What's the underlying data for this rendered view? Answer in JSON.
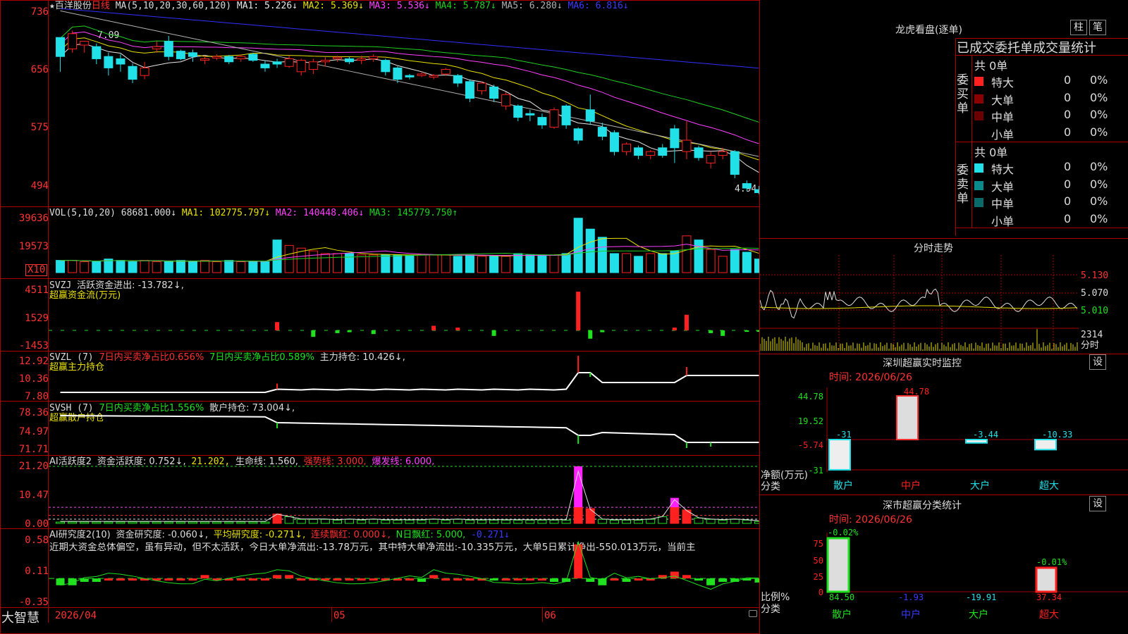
{
  "colors": {
    "up": "#ff2020",
    "down": "#22e0e8",
    "ma1": "#e8e8e8",
    "ma2": "#e8e000",
    "ma3": "#ff40ff",
    "ma4": "#20d020",
    "ma5": "#b0b0b0",
    "ma6": "#3030ff",
    "grid": "#a00000",
    "green": "#20e020"
  },
  "main": {
    "star": "★",
    "stock_name": "百洋股份",
    "period": "日线",
    "ma_label": "MA(5,10,20,30,60,120)",
    "ma1": "MA1: 5.226↓",
    "ma2": "MA2: 5.369↓",
    "ma3": "MA3: 5.536↓",
    "ma4": "MA4: 5.787↓",
    "ma5": "MA5: 6.280↓",
    "ma6": "MA6: 6.816↓",
    "high_label": "7.09",
    "low_label": "4.94",
    "y_ticks": [
      "736",
      "656",
      "575",
      "494"
    ]
  },
  "vol": {
    "label": "VOL(5,10,20)",
    "value": "68681.000↓",
    "ma1": "MA1: 102775.797↓",
    "ma2": "MA2: 140448.406↓",
    "ma3": "MA3: 145779.750↑",
    "y_ticks": [
      "39636",
      "19573"
    ],
    "unit": "X10"
  },
  "svzj": {
    "label": "SVZJ",
    "text": "活跃资金进出: -13.782↓,",
    "sub": "超赢资金流(万元)",
    "y_ticks": [
      "4511",
      "1529",
      "-1453"
    ]
  },
  "svzl": {
    "label": "SVZL (7)",
    "t1": "7日内买卖净占比0.656%",
    "t2": "7日内买卖净占比0.589%",
    "t3": "主力持仓: 10.426↓,",
    "sub": "超赢主力持仓",
    "y_ticks": [
      "12.92",
      "10.36",
      "7.80"
    ]
  },
  "svsh": {
    "label": "SVSH (7)",
    "t1": "7日内买卖净占比1.556%",
    "t2": "散户持仓: 73.004↓,",
    "sub": "超赢散户持仓",
    "y_ticks": [
      "78.36",
      "74.97",
      "71.71"
    ]
  },
  "ai2": {
    "label": "AI活跃度2",
    "t1": "资金活跃度: 0.752↓,",
    "t2": "21.202,",
    "t3": "生命线: 1.560,",
    "t4": "强势线: 3.000,",
    "t5": "爆发线: 6.000,",
    "y_ticks": [
      "21.20",
      "10.47",
      "0.00"
    ]
  },
  "ai_research": {
    "label": "AI研究度2(10)",
    "t1": "资金研究度: -0.060↓,",
    "t2": "平均研究度: -0.271↓,",
    "t3": "连续飘红: 0.000↓,",
    "t4": "N日飘红: 5.000,",
    "t5": "-0.271↓",
    "comment": "近期大资金总体偏空，虽有异动，但不太活跃，今日大单净流出:-13.78万元，其中特大单净流出:-10.335万元，大单5日累计净出-550.013万元，当前主",
    "y_ticks": [
      "0.58",
      "0.11",
      "-0.35"
    ]
  },
  "bottom": {
    "brand": "大智慧",
    "dates": [
      "2026/04",
      "05",
      "06"
    ]
  },
  "right": {
    "lhb_title": "龙虎看盘(逐单)",
    "btn1": "柱",
    "btn2": "笔",
    "tabs": "已成交委托单成交量统计",
    "buy": {
      "label": "委买单",
      "count": "共 0单",
      "rows": [
        {
          "name": "特大",
          "v": "0",
          "p": "0%"
        },
        {
          "name": "大单",
          "v": "0",
          "p": "0%"
        },
        {
          "name": "中单",
          "v": "0",
          "p": "0%"
        },
        {
          "name": "小单",
          "v": "0",
          "p": "0%"
        }
      ]
    },
    "sell": {
      "label": "委卖单",
      "count": "共 0单",
      "rows": [
        {
          "name": "特大",
          "v": "0",
          "p": "0%"
        },
        {
          "name": "大单",
          "v": "0",
          "p": "0%"
        },
        {
          "name": "中单",
          "v": "0",
          "p": "0%"
        },
        {
          "name": "小单",
          "v": "0",
          "p": "0%"
        }
      ]
    },
    "intraday_title": "分时走势",
    "intraday_ticks": [
      "5.130",
      "5.070",
      "5.010",
      "2314",
      "分时"
    ],
    "monitor": {
      "title": "深圳超赢实时监控",
      "btn": "设",
      "time": "时间: 2026/06/26",
      "y_ticks": [
        "44.78",
        "19.52",
        "-5.74",
        "-31"
      ],
      "ylabel": "净额(万元)",
      "xlabel": "分类",
      "cats": [
        "散户",
        "中户",
        "大户",
        "超大"
      ],
      "values": [
        "-31",
        "44.78",
        "-3.44",
        "-10.33"
      ]
    },
    "classify": {
      "title": "深市超赢分类统计",
      "btn": "设",
      "time": "时间: 2026/06/26",
      "y_ticks": [
        "75",
        "50",
        "25",
        "0"
      ],
      "ylabel": "比例%",
      "xlabel": "分类",
      "cats": [
        "散户",
        "中户",
        "大户",
        "超大"
      ],
      "top_labels": [
        "-0.02%",
        "-0.01%"
      ],
      "bottom_vals": [
        "84.50",
        "-1.93",
        "-19.91",
        "37.34"
      ]
    }
  },
  "chart_data": [
    {
      "type": "candlestick",
      "title": "百洋股份 日线",
      "ylim": [
        4.9,
        7.4
      ],
      "ohlc": [
        [
          7.0,
          6.75,
          6.55,
          6.98
        ],
        [
          6.85,
          7.05,
          6.8,
          7.09
        ],
        [
          6.9,
          6.95,
          6.8,
          6.9
        ],
        [
          6.88,
          6.72,
          6.65,
          6.92
        ],
        [
          6.75,
          6.6,
          6.5,
          6.8
        ],
        [
          6.72,
          6.65,
          6.55,
          6.78
        ],
        [
          6.62,
          6.45,
          6.4,
          6.66
        ],
        [
          6.5,
          6.6,
          6.45,
          6.68
        ],
        [
          6.85,
          6.88,
          6.8,
          6.95
        ],
        [
          6.95,
          6.75,
          6.7,
          7.02
        ],
        [
          6.82,
          6.72,
          6.7,
          6.84
        ],
        [
          6.8,
          6.75,
          6.68,
          6.84
        ],
        [
          6.7,
          6.72,
          6.65,
          6.76
        ],
        [
          6.73,
          6.75,
          6.7,
          6.78
        ],
        [
          6.75,
          6.68,
          6.65,
          6.77
        ],
        [
          6.72,
          6.75,
          6.68,
          6.78
        ],
        [
          6.78,
          6.7,
          6.68,
          6.8
        ],
        [
          6.65,
          6.6,
          6.55,
          6.7
        ],
        [
          6.68,
          6.65,
          6.6,
          6.72
        ],
        [
          6.62,
          6.72,
          6.6,
          6.76
        ],
        [
          6.55,
          6.7,
          6.5,
          6.72
        ],
        [
          6.58,
          6.68,
          6.52,
          6.72
        ],
        [
          6.68,
          6.7,
          6.62,
          6.74
        ],
        [
          6.72,
          6.74,
          6.68,
          6.76
        ],
        [
          6.72,
          6.68,
          6.65,
          6.75
        ],
        [
          6.7,
          6.72,
          6.65,
          6.76
        ],
        [
          6.72,
          6.75,
          6.68,
          6.78
        ],
        [
          6.7,
          6.55,
          6.5,
          6.72
        ],
        [
          6.6,
          6.45,
          6.4,
          6.62
        ],
        [
          6.5,
          6.48,
          6.45,
          6.52
        ],
        [
          6.5,
          6.52,
          6.48,
          6.55
        ],
        [
          6.48,
          6.5,
          6.45,
          6.52
        ],
        [
          6.52,
          6.58,
          6.5,
          6.6
        ],
        [
          6.5,
          6.4,
          6.35,
          6.52
        ],
        [
          6.42,
          6.2,
          6.15,
          6.45
        ],
        [
          6.3,
          6.4,
          6.25,
          6.42
        ],
        [
          6.35,
          6.2,
          6.15,
          6.38
        ],
        [
          6.1,
          6.25,
          6.05,
          6.28
        ],
        [
          6.1,
          5.95,
          5.9,
          6.12
        ],
        [
          6.0,
          5.98,
          5.9,
          6.05
        ],
        [
          5.95,
          5.85,
          5.8,
          6.0
        ],
        [
          5.82,
          6.05,
          5.8,
          6.08
        ],
        [
          6.1,
          5.85,
          5.8,
          6.12
        ],
        [
          5.8,
          5.65,
          5.6,
          5.82
        ],
        [
          6.05,
          5.9,
          5.85,
          6.25
        ],
        [
          5.82,
          5.7,
          5.65,
          5.88
        ],
        [
          5.75,
          5.5,
          5.45,
          5.78
        ],
        [
          5.5,
          5.6,
          5.45,
          5.62
        ],
        [
          5.55,
          5.45,
          5.4,
          5.58
        ],
        [
          5.45,
          5.5,
          5.4,
          5.52
        ],
        [
          5.55,
          5.45,
          5.42,
          5.6
        ],
        [
          5.8,
          5.55,
          5.35,
          5.85
        ],
        [
          5.5,
          5.65,
          5.4,
          5.9
        ],
        [
          5.55,
          5.42,
          5.38,
          5.58
        ],
        [
          5.35,
          5.45,
          5.28,
          5.5
        ],
        [
          5.45,
          5.5,
          5.4,
          5.55
        ],
        [
          5.5,
          5.2,
          5.15,
          5.52
        ],
        [
          5.08,
          5.02,
          4.98,
          5.12
        ],
        [
          5.0,
          4.96,
          4.94,
          5.05
        ]
      ],
      "x_labels": [
        "2026/04",
        "05",
        "06"
      ]
    },
    {
      "type": "bar",
      "title": "VOL(5,10,20)",
      "y_ticks": [
        39636,
        19573
      ],
      "values": [
        9,
        9,
        8,
        8,
        10,
        9,
        8,
        9,
        8,
        8,
        9,
        8,
        9,
        8,
        9,
        8,
        8,
        8,
        24,
        20,
        18,
        16,
        14,
        14,
        14,
        13,
        13,
        13,
        13,
        13,
        13,
        13,
        13,
        12,
        13,
        12,
        12,
        12,
        14,
        13,
        13,
        13,
        14,
        40,
        32,
        26,
        14,
        14,
        12,
        14,
        14,
        16,
        27,
        24,
        17,
        12,
        17,
        15,
        10
      ]
    },
    {
      "type": "bar",
      "title": "SVZJ 活跃资金进出",
      "ylim": [
        -1453,
        4511
      ],
      "values": [
        0,
        0,
        0,
        0,
        0,
        0,
        0,
        0,
        0,
        0,
        0,
        0,
        0,
        0,
        0,
        0,
        0,
        0,
        900,
        0,
        0,
        -700,
        0,
        -300,
        -200,
        0,
        -400,
        0,
        0,
        0,
        0,
        500,
        0,
        300,
        0,
        0,
        -600,
        0,
        0,
        0,
        0,
        0,
        0,
        4200,
        -900,
        -200,
        0,
        0,
        0,
        0,
        0,
        300,
        1700,
        0,
        -300,
        -600,
        0,
        -100,
        -13.782
      ]
    },
    {
      "type": "line",
      "title": "SVZL 主力持仓",
      "ylim": [
        7.8,
        12.92
      ],
      "last": 10.426
    },
    {
      "type": "line",
      "title": "SVSH 散户持仓",
      "ylim": [
        71.71,
        78.36
      ],
      "last": 73.004
    },
    {
      "type": "bar",
      "title": "AI活跃度2",
      "ylim": [
        0,
        21.2
      ],
      "values": [
        0.5,
        0.5,
        0.5,
        0.5,
        0.5,
        0.5,
        0.5,
        0.5,
        0.5,
        0.5,
        0.5,
        0.5,
        0.5,
        0.5,
        0.5,
        0.5,
        0.5,
        0.5,
        3.5,
        2.5,
        1.5,
        1.5,
        1.5,
        1.2,
        1.5,
        1.2,
        1.5,
        1.2,
        1.2,
        1.2,
        1.2,
        1.5,
        1.2,
        1.5,
        1.2,
        1.2,
        1.2,
        1.2,
        1.2,
        1.2,
        1.2,
        1.2,
        1.2,
        21.2,
        5.5,
        1.5,
        1.2,
        1.2,
        1.2,
        1.5,
        2.5,
        9.5,
        5.0,
        2.0,
        1.5,
        1.2,
        1.5,
        1.2,
        0.752
      ]
    },
    {
      "type": "bar",
      "title": "AI研究度2(10)",
      "ylim": [
        -0.35,
        0.58
      ],
      "values": [
        -0.1,
        -0.1,
        -0.05,
        -0.05,
        0,
        0,
        0,
        0,
        0,
        0,
        0,
        0,
        0.05,
        0,
        0,
        0,
        0,
        0,
        0.05,
        0.05,
        0,
        0,
        0,
        0,
        0,
        0,
        0,
        0,
        0,
        0,
        -0.05,
        0.05,
        0,
        0,
        0,
        0,
        -0.02,
        0,
        0,
        0,
        0,
        -0.05,
        -0.05,
        0.5,
        -0.05,
        -0.1,
        0,
        -0.05,
        0,
        0,
        0.05,
        0.1,
        0.05,
        -0.02,
        -0.1,
        -0.05,
        -0.05,
        -0.03,
        -0.06
      ]
    },
    {
      "type": "line",
      "title": "分时走势",
      "ylim": [
        4.98,
        5.16
      ]
    },
    {
      "type": "bar",
      "title": "深圳超赢实时监控",
      "categories": [
        "散户",
        "中户",
        "大户",
        "超大"
      ],
      "values": [
        -31,
        44.78,
        -3.44,
        -10.33
      ],
      "ylabel": "净额(万元)",
      "xlabel": "分类"
    },
    {
      "type": "bar",
      "title": "深市超赢分类统计",
      "categories": [
        "散户",
        "中户",
        "大户",
        "超大"
      ],
      "values": [
        84.5,
        -1.93,
        -19.91,
        37.34
      ],
      "ylabel": "比例%",
      "xlabel": "分类"
    }
  ]
}
